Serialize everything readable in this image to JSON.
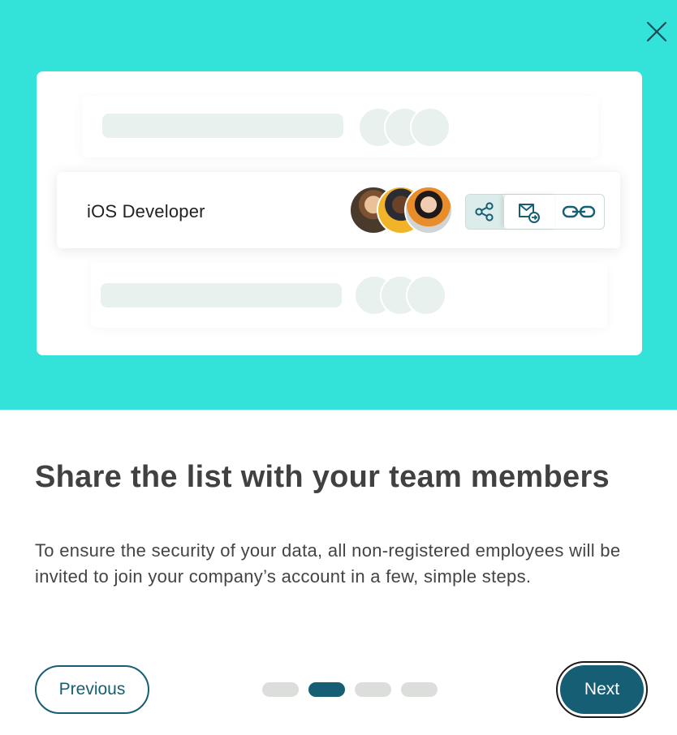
{
  "colors": {
    "hero_background": "#33e3da",
    "primary": "#155e74",
    "skeleton": "#d7e6e1",
    "inactive_dot": "#dcdedb"
  },
  "modal": {
    "close_icon": "close-icon"
  },
  "illustration": {
    "job_title": "iOS Developer",
    "avatars": [
      "avatar-woman-blonde",
      "avatar-man-glasses",
      "avatar-woman-dark-hair"
    ],
    "actions": [
      "share-icon",
      "email-forward-icon",
      "link-icon"
    ]
  },
  "content": {
    "title": "Share the list with your team members",
    "description": "To ensure the security of your data, all non-registered employees will be invited to join your company’s account in a few, simple steps."
  },
  "navigation": {
    "previous_label": "Previous",
    "next_label": "Next",
    "total_steps": 4,
    "current_step": 2
  }
}
